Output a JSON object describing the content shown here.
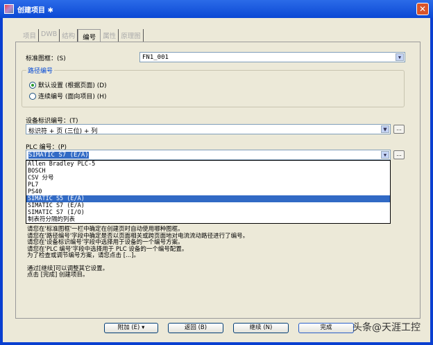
{
  "window": {
    "title": "创建项目 ✱",
    "close": "✕"
  },
  "tabs": [
    {
      "label": "项目"
    },
    {
      "label": "DWB"
    },
    {
      "label": "结构"
    },
    {
      "label": "编号"
    },
    {
      "label": "属性"
    },
    {
      "label": "原理图"
    }
  ],
  "standard_frame": {
    "label": "标准图框：(S)",
    "value": "FN1_001"
  },
  "path_numbering": {
    "title": "路径编号",
    "options": [
      {
        "label": "默认设置 (根据页面)  (D)",
        "checked": true
      },
      {
        "label": "连续编号 (面向项目)  (H)",
        "checked": false
      }
    ]
  },
  "device_id": {
    "label": "设备标识编号：(T)",
    "value": "标识符 + 页 (三位) + 列",
    "ellipsis": "..."
  },
  "plc": {
    "label": "PLC 编号：(P)",
    "value": "SIMATIC S7 (E/A)",
    "ellipsis": "...",
    "options": [
      "Allen Bradley PLC-5",
      "BOSCH",
      "CSV 分号",
      "PL7",
      "PS40",
      "SIMATIC S5 (E/A)",
      "SIMATIC S7 (E/A)",
      "SIMATIC S7 (I/O)",
      "制表符分隔的列表"
    ],
    "highlighted_index": 5
  },
  "description": [
    "请您在'标准图框'一栏中确定在创建页时自动使用哪种图框。",
    "请您在'路径编号'字段中确定是否以页面相关或跨页面地对电流流动路径进行了编号。",
    "请您在'设备标识编号'字段中选择用于设备的一个编号方案。",
    "请您在'PLC 编号'字段中选择用于 PLC 设备的一个编号配置。",
    "为了检查或调节编号方案，请您点击 [...]。",
    "",
    "通过[继续]可以调整其它设置。",
    "点击 [完成] 创建项目。"
  ],
  "buttons": {
    "extra": "附加 (E)  ▾",
    "back": "返回 (B)",
    "next": "继续 (N)",
    "finish": "完成"
  },
  "watermark": "头条@天涯工控"
}
